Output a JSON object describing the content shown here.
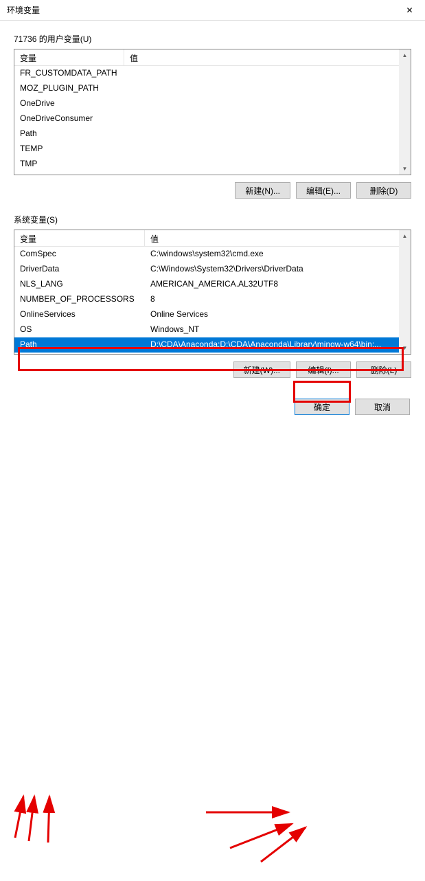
{
  "window": {
    "title": "环境变量",
    "close_icon": "✕"
  },
  "user_vars": {
    "label": "71736 的用户变量(U)",
    "header_var": "变量",
    "header_val": "值",
    "rows": [
      {
        "name": "FR_CUSTOMDATA_PATH",
        "value": ""
      },
      {
        "name": "MOZ_PLUGIN_PATH",
        "value": ""
      },
      {
        "name": "OneDrive",
        "value": ""
      },
      {
        "name": "OneDriveConsumer",
        "value": ""
      },
      {
        "name": "Path",
        "value": ""
      },
      {
        "name": "TEMP",
        "value": ""
      },
      {
        "name": "TMP",
        "value": ""
      }
    ],
    "buttons": {
      "new": "新建(N)...",
      "edit": "编辑(E)...",
      "delete": "删除(D)"
    }
  },
  "sys_vars": {
    "label": "系统变量(S)",
    "header_var": "变量",
    "header_val": "值",
    "rows": [
      {
        "name": "ComSpec",
        "value": "C:\\windows\\system32\\cmd.exe"
      },
      {
        "name": "DriverData",
        "value": "C:\\Windows\\System32\\Drivers\\DriverData"
      },
      {
        "name": "NLS_LANG",
        "value": "AMERICAN_AMERICA.AL32UTF8"
      },
      {
        "name": "NUMBER_OF_PROCESSORS",
        "value": "8"
      },
      {
        "name": "OnlineServices",
        "value": "Online Services"
      },
      {
        "name": "OS",
        "value": "Windows_NT"
      },
      {
        "name": "Path",
        "value": "D:\\CDA\\Anaconda;D:\\CDA\\Anaconda\\Library\\mingw-w64\\bin;..."
      }
    ],
    "selected_index": 6,
    "buttons": {
      "new": "新建(W)...",
      "edit": "编辑(I)...",
      "delete": "删除(L)"
    }
  },
  "dialog": {
    "ok": "确定",
    "cancel": "取消"
  },
  "scroll": {
    "up": "▲",
    "down": "▼"
  }
}
